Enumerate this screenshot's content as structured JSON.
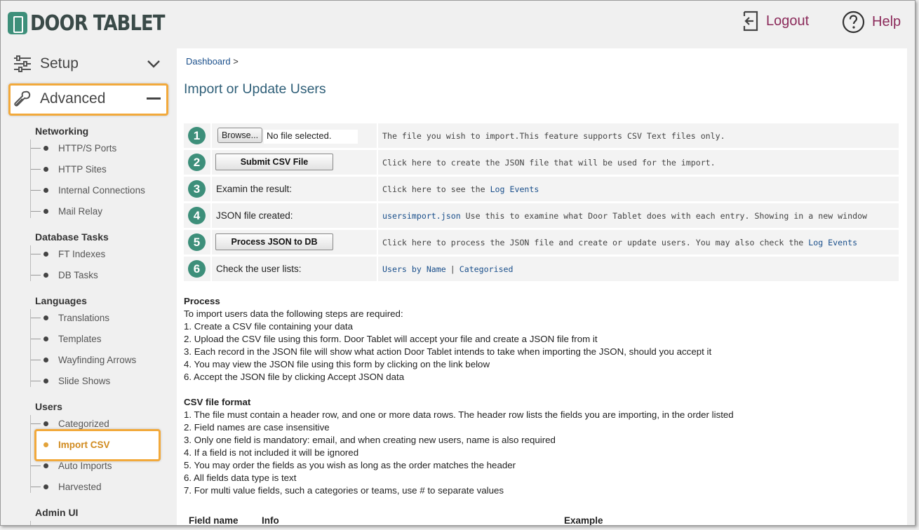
{
  "header": {
    "logo_text": "DOOR TABLET",
    "logout_label": "Logout",
    "help_label": "Help"
  },
  "sidebar": {
    "setup_label": "Setup",
    "advanced_label": "Advanced",
    "sections": [
      {
        "title": "Networking",
        "items": [
          "HTTP/S Ports",
          "HTTP Sites",
          "Internal Connections",
          "Mail Relay"
        ]
      },
      {
        "title": "Database Tasks",
        "items": [
          "FT Indexes",
          "DB Tasks"
        ]
      },
      {
        "title": "Languages",
        "items": [
          "Translations",
          "Templates",
          "Wayfinding Arrows",
          "Slide Shows"
        ]
      },
      {
        "title": "Users",
        "items": [
          "Categorized",
          "Import CSV",
          "Auto Imports",
          "Harvested"
        ]
      },
      {
        "title": "Admin UI",
        "items": []
      }
    ],
    "active_item": "Import CSV"
  },
  "main": {
    "breadcrumb": {
      "home": "Dashboard",
      "sep": ">"
    },
    "title": "Import or Update Users",
    "steps": [
      {
        "num": "1",
        "browse_label": "Browse...",
        "file_status": "No file selected.",
        "info": "The file you wish to import.This feature supports CSV Text files only."
      },
      {
        "num": "2",
        "button": "Submit CSV File",
        "info": "Click here to create the JSON file that will be used for the import."
      },
      {
        "num": "3",
        "label": "Examin the result:",
        "info": "Click here to see the ",
        "link": "Log Events"
      },
      {
        "num": "4",
        "label": "JSON file created:",
        "link": "usersimport.json",
        "info": " Use this to examine what Door Tablet does with each entry. Showing in a new window"
      },
      {
        "num": "5",
        "button": "Process JSON to DB",
        "info": "Click here to process the JSON file and create or update users. You may also check the ",
        "link": "Log Events"
      },
      {
        "num": "6",
        "label": "Check the user lists:",
        "link1": "Users by Name",
        "sep": "|",
        "link2": "Categorised"
      }
    ],
    "process": {
      "heading": "Process",
      "intro": "To import users data the following steps are required:",
      "lines": [
        "1. Create a CSV file containing your data",
        "2. Upload the CSV file using this form. Door Tablet will accept your file and create a JSON file from it",
        "3. Each record in the JSON file will show what action Door Tablet intends to take when importing the JSON, should you accept it",
        "4. You may view the JSON file using this form by clicking on the link below",
        "6. Accept the JSON file by clicking Accept JSON data"
      ]
    },
    "csv_format": {
      "heading": "CSV file format",
      "lines": [
        "1. The file must contain a header row, and one or more data rows. The header row lists the fields you are importing, in the order listed",
        "2. Field names are case insensitive",
        "3. Only one field is mandatory: email, and when creating new users, name is also required",
        "4. If a field is not included it will be ignored",
        "5. You may order the fields as you wish as long as the order matches the header",
        "6. All fields data type is text",
        "7. For multi value fields, such a categories or teams, use # to separate values"
      ]
    },
    "table_headers": [
      "Field name",
      "Info",
      "Example"
    ]
  },
  "colors": {
    "accent": "#8b2a5a",
    "badge": "#3d8f7a",
    "highlight": "#f2a93b",
    "link": "#1a4f8b"
  }
}
